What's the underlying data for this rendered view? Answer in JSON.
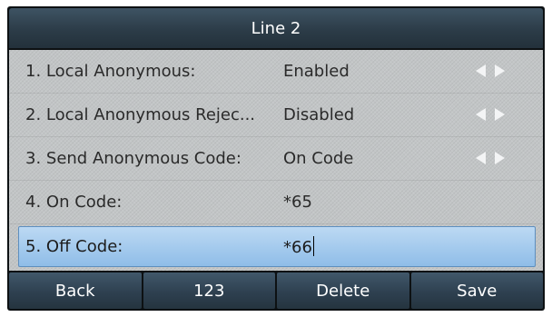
{
  "title": "Line 2",
  "rows": [
    {
      "label": "1. Local Anonymous:",
      "value": "Enabled",
      "has_arrows": true
    },
    {
      "label": "2. Local Anonymous Rejec...",
      "value": "Disabled",
      "has_arrows": true
    },
    {
      "label": "3. Send Anonymous Code:",
      "value": "On Code",
      "has_arrows": true
    },
    {
      "label": "4. On Code:",
      "value": "*65",
      "has_arrows": false
    },
    {
      "label": "5. Off Code:",
      "value": "*66",
      "has_arrows": false,
      "selected": true
    }
  ],
  "softkeys": [
    "Back",
    "123",
    "Delete",
    "Save"
  ],
  "colors": {
    "title_bar": "#2c3c48",
    "content_bg": "#c2c5c6",
    "selected_row": "#8fbde8",
    "softkey": "#2e4050"
  },
  "icons": {
    "left_arrow": "left-arrow-icon",
    "right_arrow": "right-arrow-icon"
  }
}
